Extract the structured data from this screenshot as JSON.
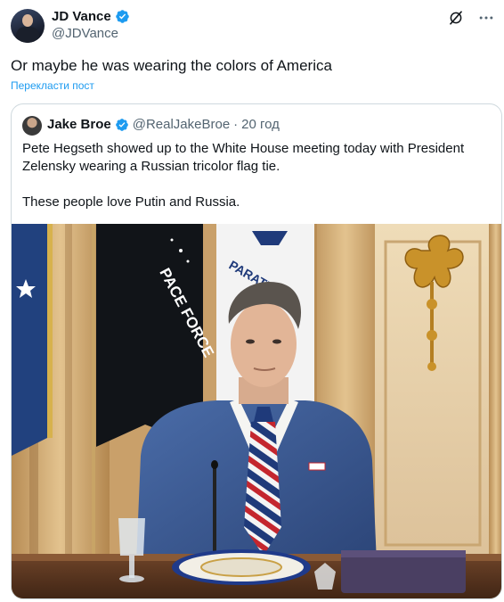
{
  "tweet": {
    "author_name": "JD Vance",
    "author_handle": "@JDVance",
    "text": "Or maybe he was wearing the colors of America",
    "translate_label": "Перекласти пост",
    "icons": [
      "grok-icon",
      "more-icon"
    ]
  },
  "quote": {
    "author_name": "Jake Broe",
    "author_handle": "@RealJakeBroe",
    "separator": "·",
    "time": "20 год",
    "text_p1": "Pete Hegseth showed up to the White House meeting today with President Zelensky wearing a Russian tricolor flag tie.",
    "text_p2": "These people love Putin and Russia.",
    "photo": {
      "flag_text_left": "PACE FORCE",
      "flag_text_right": "PARATUS"
    }
  },
  "colors": {
    "accent": "#1d9bf0",
    "text": "#0f1419",
    "secondary": "#536471",
    "border": "#cfd9de"
  }
}
